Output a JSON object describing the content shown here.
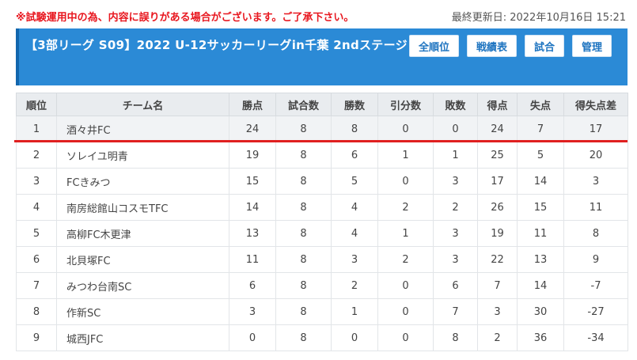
{
  "notice": "※試験運用中の為、内容に誤りがある場合がございます。ご了承下さい。",
  "updated": "最終更新日: 2022年10月16日 15:21",
  "header": {
    "title": "【3部リーグ S09】2022 U-12サッカーリーグin千葉 2ndステージ",
    "buttons": [
      "全順位",
      "戦績表",
      "試合",
      "管理"
    ]
  },
  "table": {
    "columns": [
      "順位",
      "チーム名",
      "勝点",
      "試合数",
      "勝数",
      "引分数",
      "敗数",
      "得点",
      "失点",
      "得失点差"
    ],
    "rows": [
      [
        "1",
        "酒々井FC",
        "24",
        "8",
        "8",
        "0",
        "0",
        "24",
        "7",
        "17"
      ],
      [
        "2",
        "ソレイユ明青",
        "19",
        "8",
        "6",
        "1",
        "1",
        "25",
        "5",
        "20"
      ],
      [
        "3",
        "FCきみつ",
        "15",
        "8",
        "5",
        "0",
        "3",
        "17",
        "14",
        "3"
      ],
      [
        "4",
        "南房総館山コスモTFC",
        "14",
        "8",
        "4",
        "2",
        "2",
        "26",
        "15",
        "11"
      ],
      [
        "5",
        "高柳FC木更津",
        "13",
        "8",
        "4",
        "1",
        "3",
        "19",
        "11",
        "8"
      ],
      [
        "6",
        "北貝塚FC",
        "11",
        "8",
        "3",
        "2",
        "3",
        "22",
        "13",
        "9"
      ],
      [
        "7",
        "みつわ台南SC",
        "6",
        "8",
        "2",
        "0",
        "6",
        "7",
        "14",
        "-7"
      ],
      [
        "8",
        "作新SC",
        "3",
        "8",
        "1",
        "0",
        "7",
        "3",
        "30",
        "-27"
      ],
      [
        "9",
        "城西JFC",
        "0",
        "8",
        "0",
        "0",
        "8",
        "2",
        "36",
        "-34"
      ]
    ]
  },
  "colors": {
    "header_bg": "#2b8ad6",
    "notice": "#e8171f",
    "promotion_line": "#e02020"
  }
}
